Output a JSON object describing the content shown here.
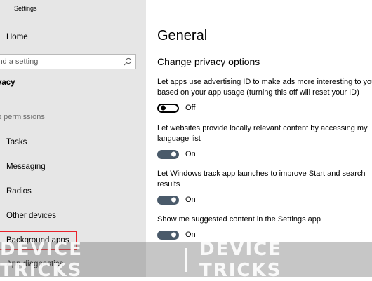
{
  "window": {
    "title": "Settings"
  },
  "sidebar": {
    "home_label": "Home",
    "search_placeholder": "ind a setting",
    "section_label": "vacy",
    "group_label": "p permissions",
    "items": [
      {
        "label": "Tasks"
      },
      {
        "label": "Messaging"
      },
      {
        "label": "Radios"
      },
      {
        "label": "Other devices"
      },
      {
        "label": "Background apps"
      },
      {
        "label": "App diagnostics"
      }
    ]
  },
  "main": {
    "title": "General",
    "subtitle": "Change privacy options",
    "settings": [
      {
        "line1": "Let apps use advertising ID to make ads more interesting to you",
        "line2": "based on your app usage (turning this off will reset your ID)",
        "state": "Off"
      },
      {
        "line1": "Let websites provide locally relevant content by accessing my",
        "line2": "language list",
        "state": "On"
      },
      {
        "line1": "Let Windows track app launches to improve Start and search",
        "line2": "results",
        "state": "On"
      },
      {
        "line1": "Show me suggested content in the Settings app",
        "line2": "",
        "state": "On"
      }
    ]
  },
  "watermark": {
    "left_text": "DEVICE TRICKS",
    "right_text": "DEVICE TRICKS"
  },
  "colors": {
    "highlight": "#e8212a",
    "toggle_on": "#4a5a6a",
    "sidebar_bg": "#e6e6e6"
  },
  "icons": {
    "search": "search-icon"
  }
}
